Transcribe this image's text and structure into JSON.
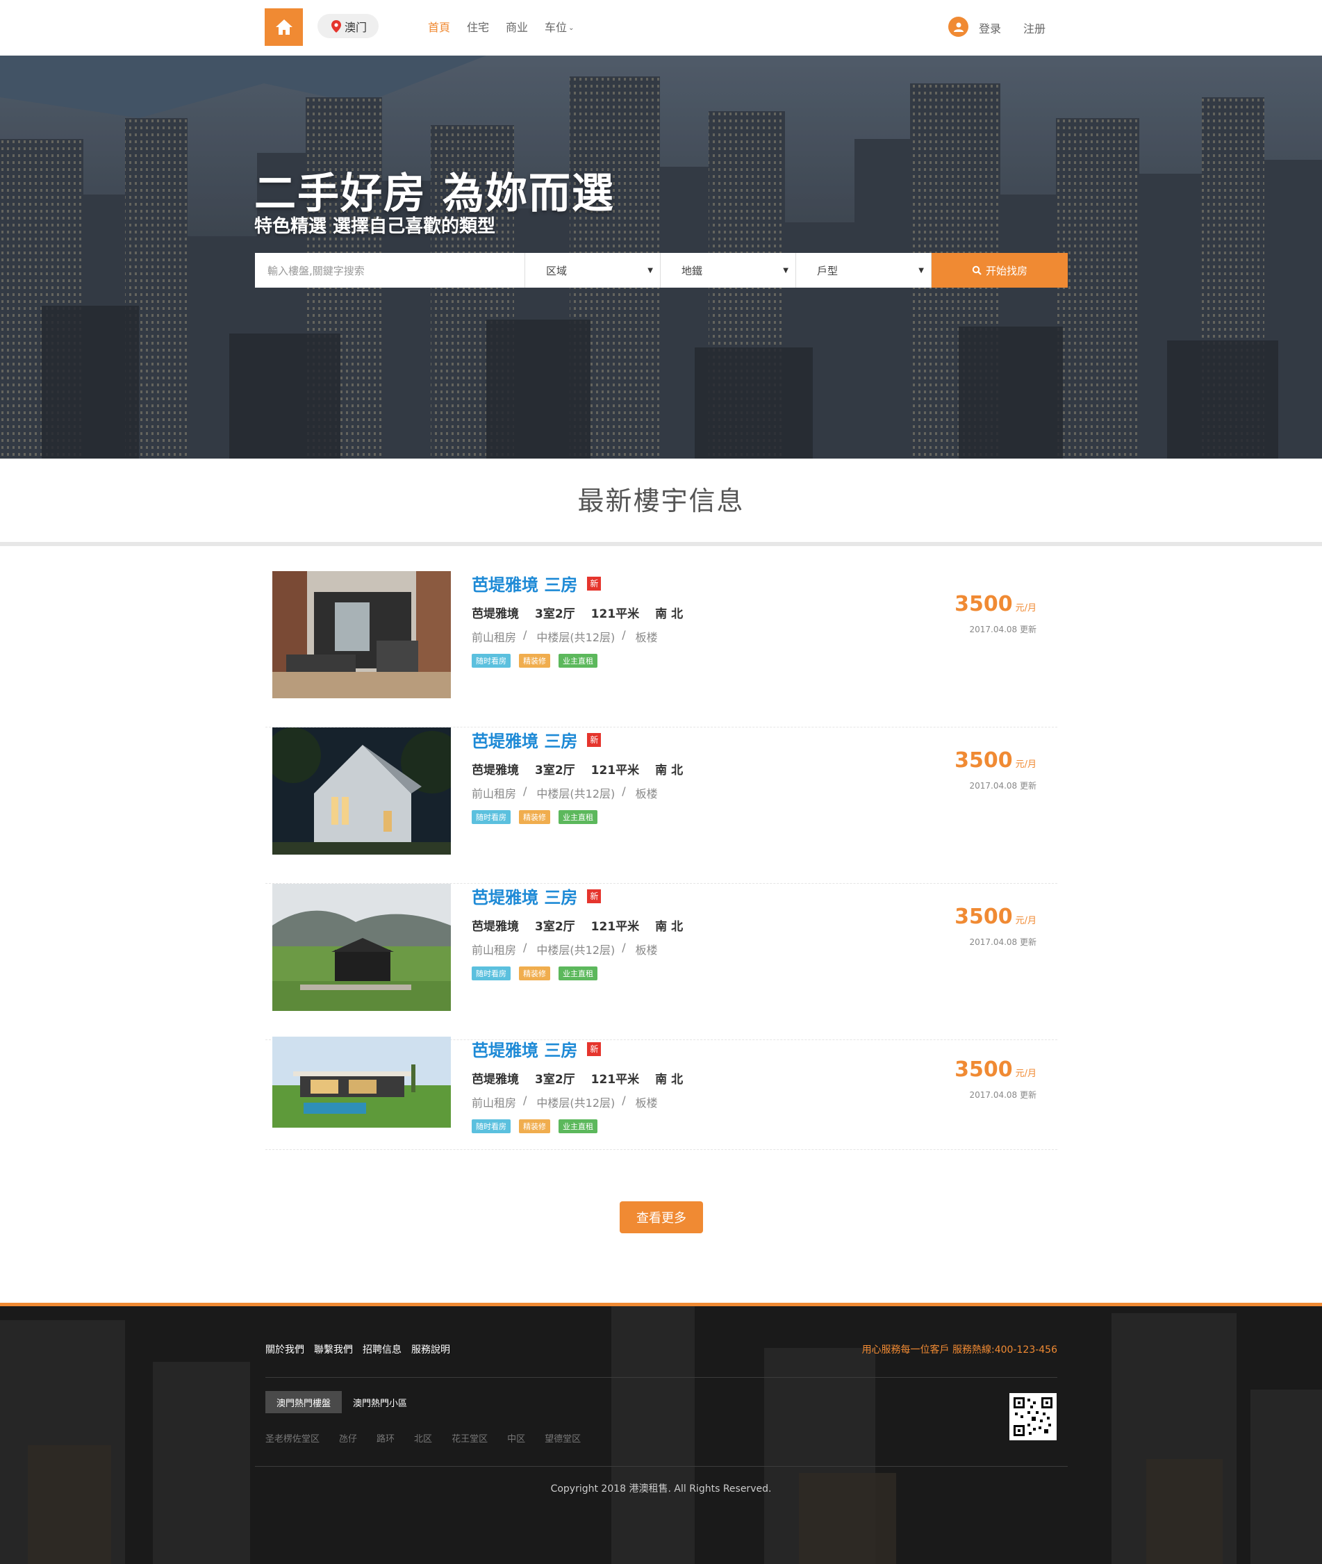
{
  "header": {
    "city": "澳门",
    "nav": [
      {
        "label": "首頁",
        "active": true
      },
      {
        "label": "住宅",
        "active": false
      },
      {
        "label": "商业",
        "active": false
      },
      {
        "label": "车位",
        "active": false
      }
    ],
    "login": "登录",
    "register": "注册"
  },
  "hero": {
    "title": "二手好房 為妳而選",
    "subtitle": "特色精選 選擇自己喜歡的類型",
    "search": {
      "placeholder": "輸入樓盤,關鍵字搜索",
      "district": "区域",
      "metro": "地鐵",
      "layout": "戶型",
      "button": "开始找房"
    }
  },
  "section_title": "最新樓宇信息",
  "listings": [
    {
      "name": "芭堤雅境 三房",
      "badge": "新",
      "specs": [
        "芭堤雅境",
        "3室2厅",
        "121平米",
        "南 北"
      ],
      "meta": [
        "前山租房",
        "中楼层(共12层)",
        "板楼"
      ],
      "tags": [
        "随时看房",
        "精装修",
        "业主直租"
      ],
      "price": "3500",
      "unit": "元/月",
      "updated": "2017.04.08 更新"
    },
    {
      "name": "芭堤雅境 三房",
      "badge": "新",
      "specs": [
        "芭堤雅境",
        "3室2厅",
        "121平米",
        "南 北"
      ],
      "meta": [
        "前山租房",
        "中楼层(共12层)",
        "板楼"
      ],
      "tags": [
        "随时看房",
        "精装修",
        "业主直租"
      ],
      "price": "3500",
      "unit": "元/月",
      "updated": "2017.04.08 更新"
    },
    {
      "name": "芭堤雅境 三房",
      "badge": "新",
      "specs": [
        "芭堤雅境",
        "3室2厅",
        "121平米",
        "南 北"
      ],
      "meta": [
        "前山租房",
        "中楼层(共12层)",
        "板楼"
      ],
      "tags": [
        "随时看房",
        "精装修",
        "业主直租"
      ],
      "price": "3500",
      "unit": "元/月",
      "updated": "2017.04.08 更新"
    },
    {
      "name": "芭堤雅境 三房",
      "badge": "新",
      "specs": [
        "芭堤雅境",
        "3室2厅",
        "121平米",
        "南 北"
      ],
      "meta": [
        "前山租房",
        "中楼层(共12层)",
        "板楼"
      ],
      "tags": [
        "随时看房",
        "精装修",
        "业主直租"
      ],
      "price": "3500",
      "unit": "元/月",
      "updated": "2017.04.08 更新"
    }
  ],
  "more_button": "查看更多",
  "footer": {
    "links": [
      "關於我們",
      "聯繫我們",
      "招聘信息",
      "服務說明"
    ],
    "hotline": "用心服務每一位客戶 服務熱線:400-123-456",
    "tabs": [
      "澳門熱門樓盤",
      "澳門熱門小區"
    ],
    "areas": [
      "圣老楞佐堂区",
      "氹仔",
      "路环",
      "北区",
      "花王堂区",
      "中区",
      "望德堂区"
    ],
    "copyright": "Copyright 2018 港澳租售. All Rights Reserved."
  },
  "colors": {
    "accent": "#f08a33",
    "link_blue": "#1e8ad6",
    "badge_red": "#e5352d"
  }
}
